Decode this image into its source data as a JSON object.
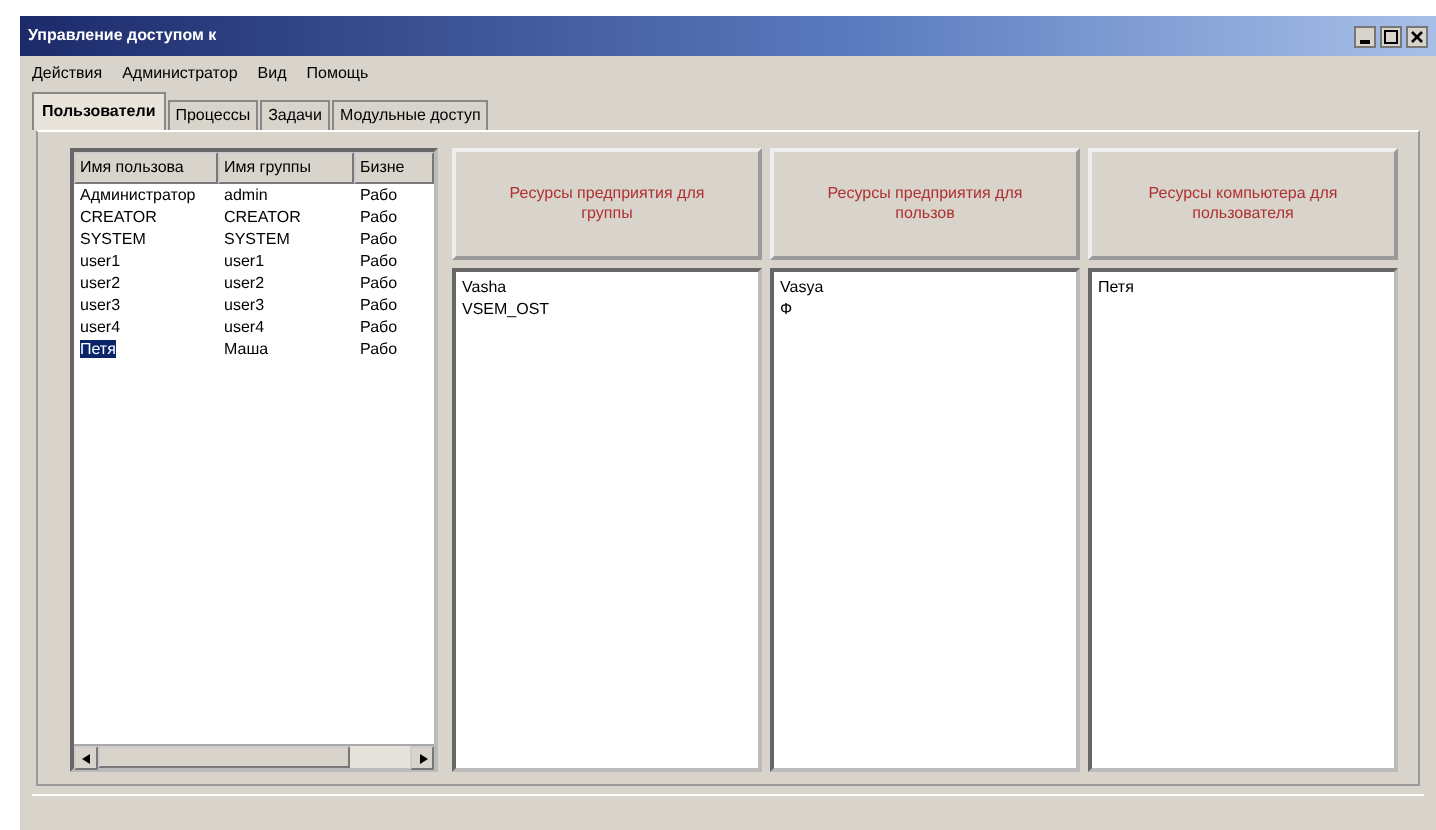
{
  "window": {
    "title": "Управление доступом к"
  },
  "menu": [
    "Действия",
    "Администратор",
    "Вид",
    "Помощь"
  ],
  "tabs": [
    {
      "label": "Пользователи",
      "selected": true
    },
    {
      "label": "Процессы",
      "selected": false
    },
    {
      "label": "Задачи",
      "selected": false
    },
    {
      "label": "Модульные доступ",
      "selected": false
    }
  ],
  "users_table": {
    "columns": [
      "Имя пользова",
      "Имя группы",
      "Бизне"
    ],
    "rows": [
      {
        "cells": [
          "Администратор",
          "admin",
          "Рабо"
        ],
        "selected": false
      },
      {
        "cells": [
          "CREATOR",
          "CREATOR",
          "Рабо"
        ],
        "selected": false
      },
      {
        "cells": [
          "SYSTEM",
          "SYSTEM",
          "Рабо"
        ],
        "selected": false
      },
      {
        "cells": [
          "user1",
          "user1",
          "Рабо"
        ],
        "selected": false
      },
      {
        "cells": [
          "user2",
          "user2",
          "Рабо"
        ],
        "selected": false
      },
      {
        "cells": [
          "user3",
          "user3",
          "Рабо"
        ],
        "selected": false
      },
      {
        "cells": [
          "user4",
          "user4",
          "Рабо"
        ],
        "selected": false
      },
      {
        "cells": [
          "Петя",
          "Маша",
          "Рабо"
        ],
        "selected": true
      }
    ]
  },
  "panels": [
    {
      "button": "Ресурсы предприятия для группы",
      "items": [
        "Vasha",
        "VSEM_OST"
      ]
    },
    {
      "button": "Ресурсы предприятия для пользов",
      "items": [
        "Vasya",
        "Ф"
      ]
    },
    {
      "button": "Ресурсы компьютера для пользователя",
      "items": [
        "Петя"
      ]
    }
  ]
}
